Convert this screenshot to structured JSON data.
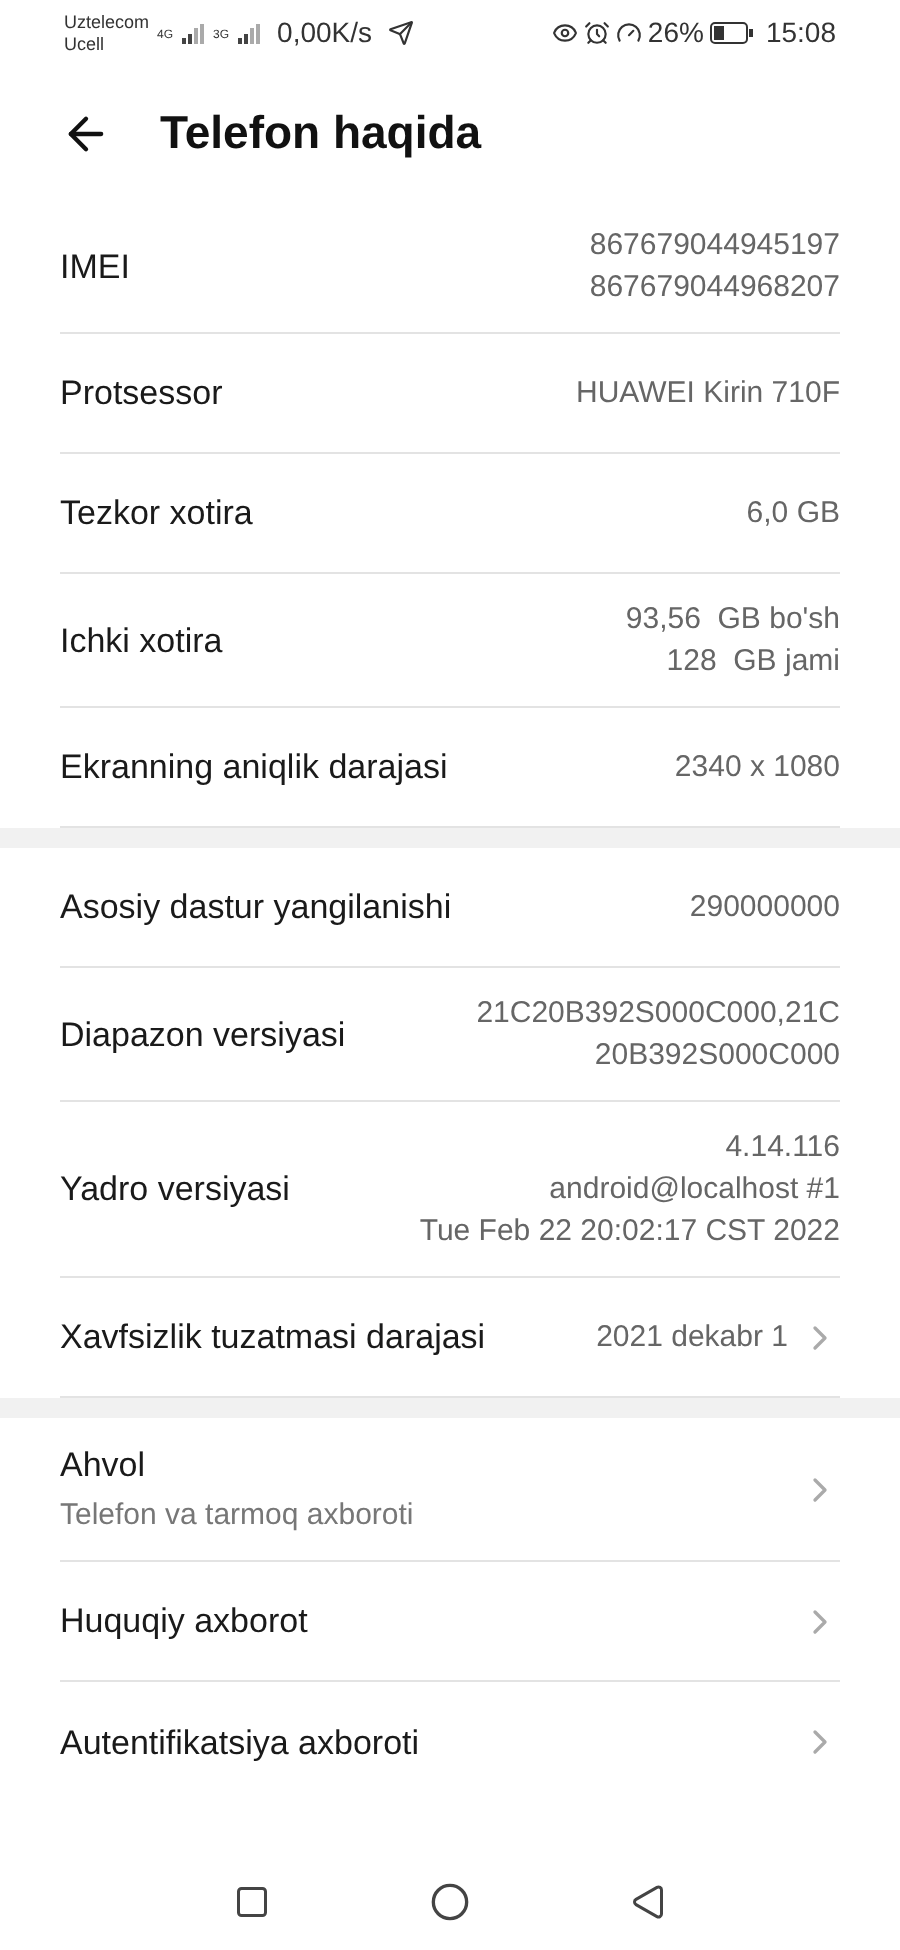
{
  "status_bar": {
    "carrier_1": "Uztelecom",
    "carrier_2": "Ucell",
    "network_1": "4G",
    "network_2": "3G",
    "speed": "0,00K/s",
    "battery": "26%",
    "time": "15:08"
  },
  "header": {
    "title": "Telefon haqida"
  },
  "sections": [
    {
      "rows": [
        {
          "label": "IMEI",
          "values": [
            "867679044945197",
            "867679044968207"
          ],
          "chevron": false
        },
        {
          "label": "Protsessor",
          "values": [
            "HUAWEI Kirin 710F"
          ],
          "chevron": false
        },
        {
          "label": "Tezkor xotira",
          "values": [
            "6,0 GB"
          ],
          "chevron": false
        },
        {
          "label": "Ichki xotira",
          "values": [
            "93,56  GB bo'sh",
            "128  GB jami"
          ],
          "chevron": false
        },
        {
          "label": "Ekranning aniqlik darajasi",
          "values": [
            "2340 x 1080"
          ],
          "chevron": false
        }
      ]
    },
    {
      "rows": [
        {
          "label": "Asosiy dastur yangilanishi",
          "values": [
            "290000000"
          ],
          "chevron": false
        },
        {
          "label": "Diapazon versiyasi",
          "values": [
            "21C20B392S000C000,21C",
            "20B392S000C000"
          ],
          "chevron": false
        },
        {
          "label": "Yadro versiyasi",
          "values": [
            "4.14.116",
            "android@localhost #1",
            "Tue Feb 22 20:02:17 CST 2022"
          ],
          "chevron": false
        },
        {
          "label": "Xavfsizlik tuzatmasi darajasi",
          "values": [
            "2021 dekabr 1"
          ],
          "chevron": true
        }
      ]
    },
    {
      "rows": [
        {
          "label": "Ahvol",
          "subtitle": "Telefon va tarmoq axboroti",
          "chevron": true
        },
        {
          "label": "Huquqiy axborot",
          "chevron": true
        },
        {
          "label": "Autentifikatsiya axboroti",
          "chevron": true
        }
      ]
    }
  ]
}
